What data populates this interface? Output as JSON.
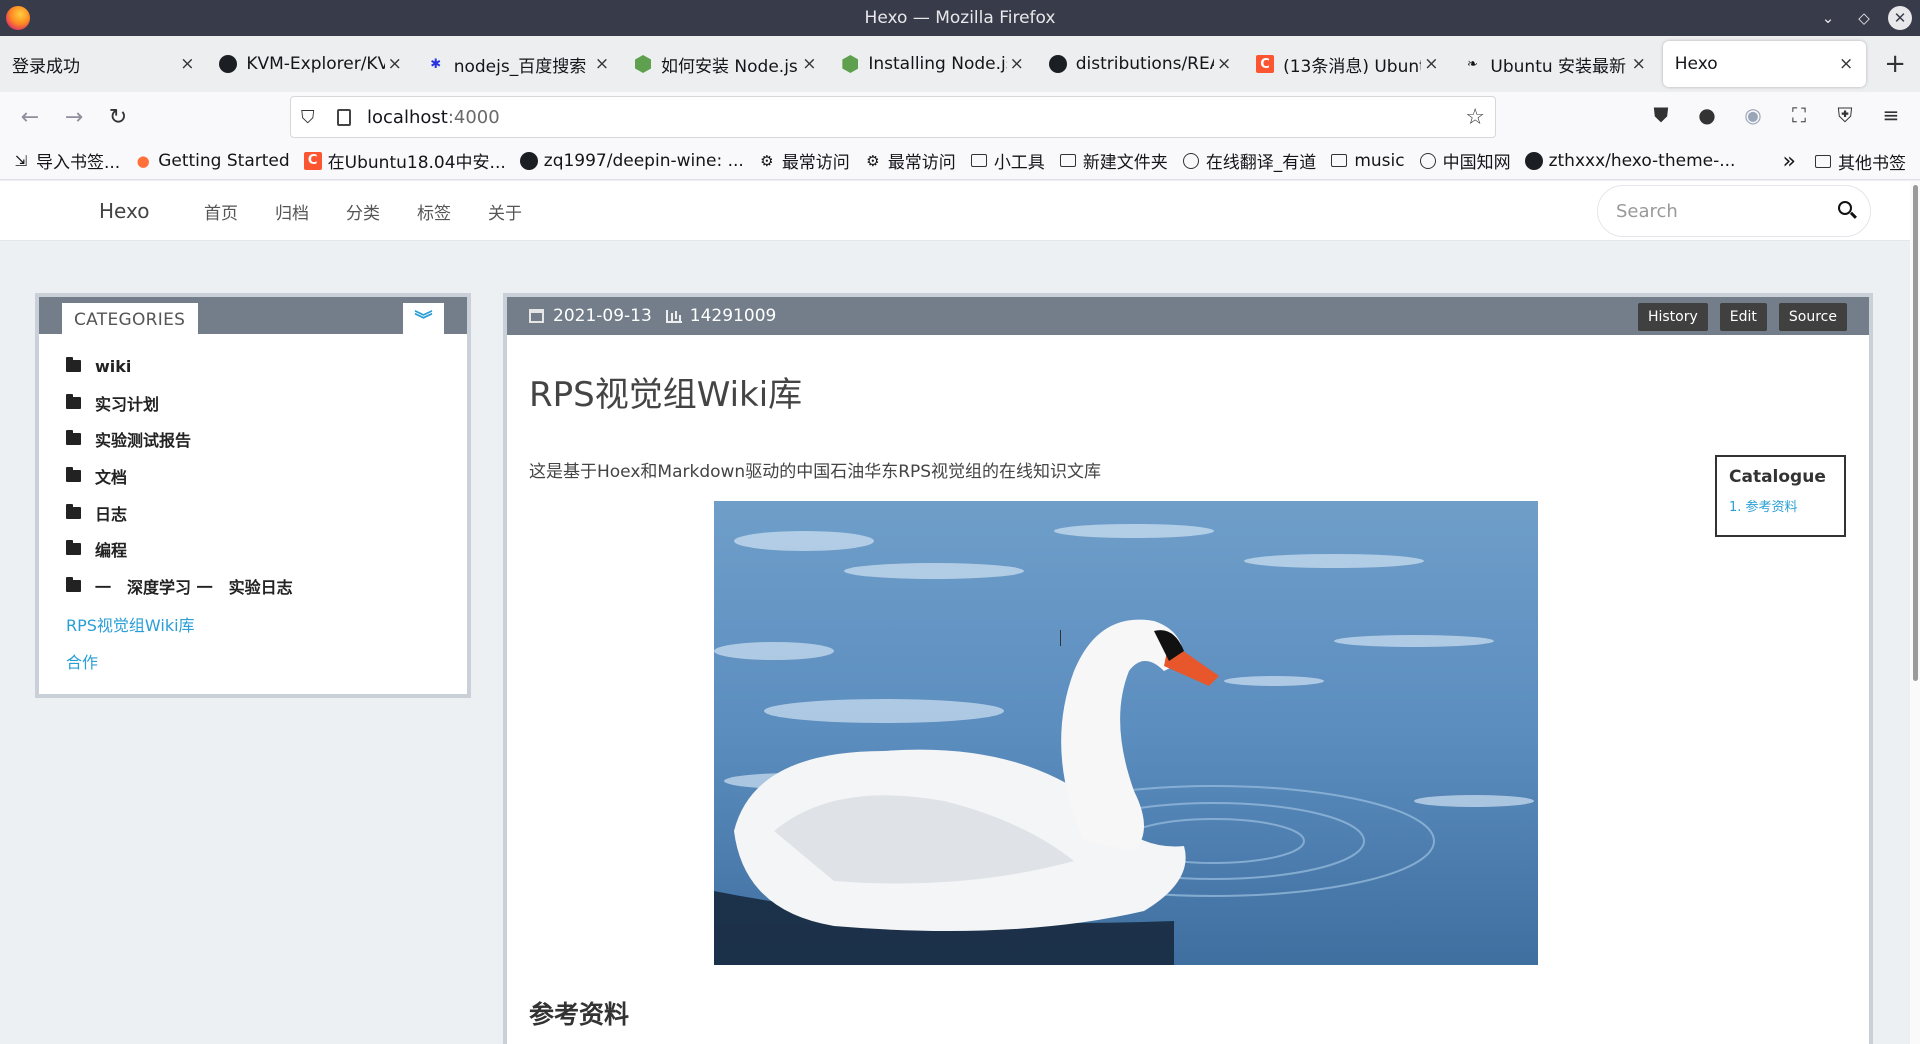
{
  "window": {
    "title": "Hexo — Mozilla Firefox"
  },
  "tabs": [
    {
      "title": "登录成功",
      "icon": "none"
    },
    {
      "title": "KVM-Explorer/KV",
      "icon": "github-icon"
    },
    {
      "title": "nodejs_百度搜索",
      "icon": "baidu-paw-icon"
    },
    {
      "title": "如何安装 Node.js",
      "icon": "nodejs-icon"
    },
    {
      "title": "Installing Node.js",
      "icon": "nodejs-icon"
    },
    {
      "title": "distributions/REA",
      "icon": "github-icon"
    },
    {
      "title": "(13条消息) Ubuntu",
      "icon": "csdn-icon"
    },
    {
      "title": "Ubuntu 安装最新",
      "icon": "link-icon"
    },
    {
      "title": "Hexo",
      "icon": "none",
      "active": true
    }
  ],
  "urlbar": {
    "host": "localhost",
    "port": ":4000"
  },
  "bookmarks": {
    "items": [
      "导入书签...",
      "Getting Started",
      "在Ubuntu18.04中安...",
      "zq1997/deepin-wine: ...",
      "最常访问",
      "最常访问",
      "小工具",
      "新建文件夹",
      "在线翻译_有道",
      "music",
      "中国知网",
      "zthxxx/hexo-theme-..."
    ],
    "more_label": "»",
    "other_label": "其他书签"
  },
  "site": {
    "brand": "Hexo",
    "menu": [
      "首页",
      "归档",
      "分类",
      "标签",
      "关于"
    ],
    "search_placeholder": "Search"
  },
  "sidebar": {
    "title": "CATEGORIES",
    "toggle_glyph": "︾",
    "categories": [
      "wiki",
      "实习计划",
      "实验测试报告",
      "文档",
      "日志",
      "编程",
      "一　深度学习 一　实验日志"
    ],
    "links": [
      "RPS视觉组Wiki库",
      "合作"
    ]
  },
  "article": {
    "date": "2021-09-13",
    "views": "14291009",
    "buttons": [
      "History",
      "Edit",
      "Source"
    ],
    "title": "RPS视觉组Wiki库",
    "description": "这是基于Hoex和Markdown驱动的中国石油华东RPS视觉组的在线知识文库",
    "catalogue_title": "Catalogue",
    "catalogue_items": [
      "1. 参考资料"
    ],
    "section_heading": "参考资料"
  },
  "colors": {
    "accent": "#2a9fd6",
    "panel_header": "#737e8a",
    "page_bg": "#ecf0f3"
  }
}
